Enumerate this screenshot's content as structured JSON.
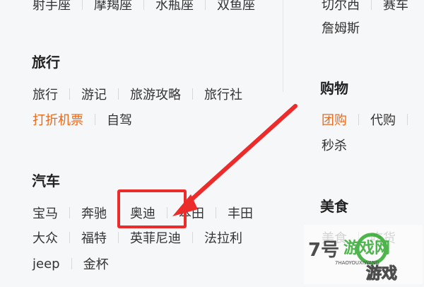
{
  "left": {
    "top_cut_items": [
      "射手座",
      "摩羯座",
      "水瓶座",
      "双鱼座"
    ],
    "travel": {
      "title": "旅行",
      "row1": [
        "旅行",
        "游记",
        "旅游攻略",
        "旅行社"
      ],
      "row2": [
        "打折机票",
        "自驾"
      ]
    },
    "cars": {
      "title": "汽车",
      "row1": [
        "宝马",
        "奔驰",
        "奥迪",
        "本田",
        "丰田"
      ],
      "row2": [
        "大众",
        "福特",
        "英菲尼迪",
        "法拉利"
      ],
      "row3": [
        "jeep",
        "金杯"
      ]
    }
  },
  "right": {
    "top_cut_items": [
      "切尔西",
      "赛车"
    ],
    "extra_item": "詹姆斯",
    "shopping": {
      "title": "购物",
      "row1": [
        "团购",
        "代购"
      ],
      "row2": [
        "秒杀"
      ]
    },
    "food": {
      "title": "美食",
      "row1": [
        "美食",
        "吃货"
      ]
    }
  },
  "watermark": {
    "logo_text": "7号",
    "brand_top": "游戏网",
    "url_text": "7HAOYOUXIWANG",
    "brand_bottom": "游戏"
  },
  "colors": {
    "highlight": "#e86a1c",
    "annotation": "#ec2b2b",
    "watermark_green": "#3cae3a"
  }
}
